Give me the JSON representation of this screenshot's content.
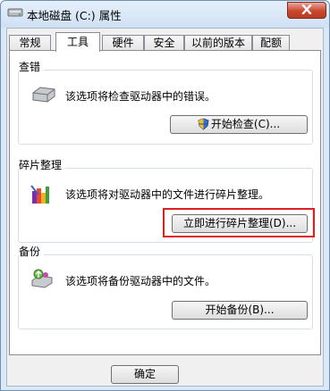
{
  "window": {
    "title": "本地磁盘 (C:) 属性",
    "icon": "drive-icon",
    "close_icon": "close-icon"
  },
  "tabs": [
    {
      "label": "常规",
      "active": false
    },
    {
      "label": "工具",
      "active": true
    },
    {
      "label": "硬件",
      "active": false
    },
    {
      "label": "安全",
      "active": false
    },
    {
      "label": "以前的版本",
      "active": false
    },
    {
      "label": "配额",
      "active": false
    }
  ],
  "groups": {
    "check": {
      "title": "查错",
      "description": "该选项将检查驱动器中的错误。",
      "button": "开始检查(C)...",
      "button_icon": "uac-shield-icon"
    },
    "defrag": {
      "title": "碎片整理",
      "description": "该选项将对驱动器中的文件进行碎片整理。",
      "button": "立即进行碎片整理(D)...",
      "highlight_color": "#e02020"
    },
    "backup": {
      "title": "备份",
      "description": "该选项将备份驱动器中的文件。",
      "button": "开始备份(B)..."
    }
  },
  "footer": {
    "ok_button": "确定"
  }
}
